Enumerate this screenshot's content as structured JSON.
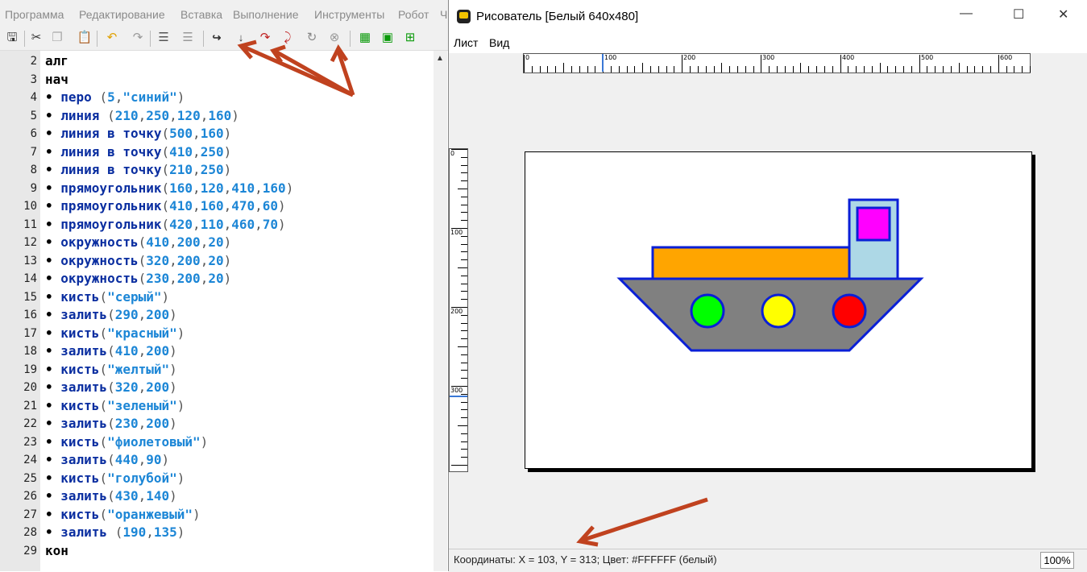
{
  "ide": {
    "menu": [
      "Программа",
      "Редактирование",
      "Вставка",
      "Выполнение",
      "Инструменты",
      "Робот",
      "Ч"
    ],
    "toolbar_icons": [
      "save-icon",
      "cut-icon",
      "copy-icon",
      "paste-icon",
      "undo-icon",
      "redo-icon",
      "indent-icon",
      "unindent-icon",
      "run-icon",
      "step-icon",
      "step-into-icon",
      "step-out-icon",
      "stop-icon",
      "grid-icon",
      "frame-icon",
      "grid-alt-icon"
    ],
    "code": [
      {
        "n": "2",
        "parts": [
          [
            "kw",
            "алг"
          ]
        ]
      },
      {
        "n": "3",
        "parts": [
          [
            "kw",
            "нач"
          ]
        ]
      },
      {
        "n": "4",
        "parts": [
          [
            "d",
            "• "
          ],
          [
            "fn",
            "перо "
          ],
          [
            "p",
            "("
          ],
          [
            "num",
            "5"
          ],
          [
            "p",
            ","
          ],
          [
            "str",
            "\"синий\""
          ],
          [
            "p",
            ")"
          ]
        ]
      },
      {
        "n": "5",
        "parts": [
          [
            "d",
            "• "
          ],
          [
            "fn",
            "линия "
          ],
          [
            "p",
            "("
          ],
          [
            "num",
            "210"
          ],
          [
            "p",
            ","
          ],
          [
            "num",
            "250"
          ],
          [
            "p",
            ","
          ],
          [
            "num",
            "120"
          ],
          [
            "p",
            ","
          ],
          [
            "num",
            "160"
          ],
          [
            "p",
            ")"
          ]
        ]
      },
      {
        "n": "6",
        "parts": [
          [
            "d",
            "• "
          ],
          [
            "fn",
            "линия в точку"
          ],
          [
            "p",
            "("
          ],
          [
            "num",
            "500"
          ],
          [
            "p",
            ","
          ],
          [
            "num",
            "160"
          ],
          [
            "p",
            ")"
          ]
        ]
      },
      {
        "n": "7",
        "parts": [
          [
            "d",
            "• "
          ],
          [
            "fn",
            "линия в точку"
          ],
          [
            "p",
            "("
          ],
          [
            "num",
            "410"
          ],
          [
            "p",
            ","
          ],
          [
            "num",
            "250"
          ],
          [
            "p",
            ")"
          ]
        ]
      },
      {
        "n": "8",
        "parts": [
          [
            "d",
            "• "
          ],
          [
            "fn",
            "линия в точку"
          ],
          [
            "p",
            "("
          ],
          [
            "num",
            "210"
          ],
          [
            "p",
            ","
          ],
          [
            "num",
            "250"
          ],
          [
            "p",
            ")"
          ]
        ]
      },
      {
        "n": "9",
        "parts": [
          [
            "d",
            "• "
          ],
          [
            "fn",
            "прямоугольник"
          ],
          [
            "p",
            "("
          ],
          [
            "num",
            "160"
          ],
          [
            "p",
            ","
          ],
          [
            "num",
            "120"
          ],
          [
            "p",
            ","
          ],
          [
            "num",
            "410"
          ],
          [
            "p",
            ","
          ],
          [
            "num",
            "160"
          ],
          [
            "p",
            ")"
          ]
        ]
      },
      {
        "n": "10",
        "parts": [
          [
            "d",
            "• "
          ],
          [
            "fn",
            "прямоугольник"
          ],
          [
            "p",
            "("
          ],
          [
            "num",
            "410"
          ],
          [
            "p",
            ","
          ],
          [
            "num",
            "160"
          ],
          [
            "p",
            ","
          ],
          [
            "num",
            "470"
          ],
          [
            "p",
            ","
          ],
          [
            "num",
            "60"
          ],
          [
            "p",
            ")"
          ]
        ]
      },
      {
        "n": "11",
        "parts": [
          [
            "d",
            "• "
          ],
          [
            "fn",
            "прямоугольник"
          ],
          [
            "p",
            "("
          ],
          [
            "num",
            "420"
          ],
          [
            "p",
            ","
          ],
          [
            "num",
            "110"
          ],
          [
            "p",
            ","
          ],
          [
            "num",
            "460"
          ],
          [
            "p",
            ","
          ],
          [
            "num",
            "70"
          ],
          [
            "p",
            ")"
          ]
        ]
      },
      {
        "n": "12",
        "parts": [
          [
            "d",
            "• "
          ],
          [
            "fn",
            "окружность"
          ],
          [
            "p",
            "("
          ],
          [
            "num",
            "410"
          ],
          [
            "p",
            ","
          ],
          [
            "num",
            "200"
          ],
          [
            "p",
            ","
          ],
          [
            "num",
            "20"
          ],
          [
            "p",
            ")"
          ]
        ]
      },
      {
        "n": "13",
        "parts": [
          [
            "d",
            "• "
          ],
          [
            "fn",
            "окружность"
          ],
          [
            "p",
            "("
          ],
          [
            "num",
            "320"
          ],
          [
            "p",
            ","
          ],
          [
            "num",
            "200"
          ],
          [
            "p",
            ","
          ],
          [
            "num",
            "20"
          ],
          [
            "p",
            ")"
          ]
        ]
      },
      {
        "n": "14",
        "parts": [
          [
            "d",
            "• "
          ],
          [
            "fn",
            "окружность"
          ],
          [
            "p",
            "("
          ],
          [
            "num",
            "230"
          ],
          [
            "p",
            ","
          ],
          [
            "num",
            "200"
          ],
          [
            "p",
            ","
          ],
          [
            "num",
            "20"
          ],
          [
            "p",
            ")"
          ]
        ]
      },
      {
        "n": "15",
        "parts": [
          [
            "d",
            "• "
          ],
          [
            "fn",
            "кисть"
          ],
          [
            "p",
            "("
          ],
          [
            "str",
            "\"серый\""
          ],
          [
            "p",
            ")"
          ]
        ]
      },
      {
        "n": "16",
        "parts": [
          [
            "d",
            "• "
          ],
          [
            "fn",
            "залить"
          ],
          [
            "p",
            "("
          ],
          [
            "num",
            "290"
          ],
          [
            "p",
            ","
          ],
          [
            "num",
            "200"
          ],
          [
            "p",
            ")"
          ]
        ]
      },
      {
        "n": "17",
        "parts": [
          [
            "d",
            "• "
          ],
          [
            "fn",
            "кисть"
          ],
          [
            "p",
            "("
          ],
          [
            "str",
            "\"красный\""
          ],
          [
            "p",
            ")"
          ]
        ]
      },
      {
        "n": "18",
        "parts": [
          [
            "d",
            "• "
          ],
          [
            "fn",
            "залить"
          ],
          [
            "p",
            "("
          ],
          [
            "num",
            "410"
          ],
          [
            "p",
            ","
          ],
          [
            "num",
            "200"
          ],
          [
            "p",
            ")"
          ]
        ]
      },
      {
        "n": "19",
        "parts": [
          [
            "d",
            "• "
          ],
          [
            "fn",
            "кисть"
          ],
          [
            "p",
            "("
          ],
          [
            "str",
            "\"желтый\""
          ],
          [
            "p",
            ")"
          ]
        ]
      },
      {
        "n": "20",
        "parts": [
          [
            "d",
            "• "
          ],
          [
            "fn",
            "залить"
          ],
          [
            "p",
            "("
          ],
          [
            "num",
            "320"
          ],
          [
            "p",
            ","
          ],
          [
            "num",
            "200"
          ],
          [
            "p",
            ")"
          ]
        ]
      },
      {
        "n": "21",
        "parts": [
          [
            "d",
            "• "
          ],
          [
            "fn",
            "кисть"
          ],
          [
            "p",
            "("
          ],
          [
            "str",
            "\"зеленый\""
          ],
          [
            "p",
            ")"
          ]
        ]
      },
      {
        "n": "22",
        "parts": [
          [
            "d",
            "• "
          ],
          [
            "fn",
            "залить"
          ],
          [
            "p",
            "("
          ],
          [
            "num",
            "230"
          ],
          [
            "p",
            ","
          ],
          [
            "num",
            "200"
          ],
          [
            "p",
            ")"
          ]
        ]
      },
      {
        "n": "23",
        "parts": [
          [
            "d",
            "• "
          ],
          [
            "fn",
            "кисть"
          ],
          [
            "p",
            "("
          ],
          [
            "str",
            "\"фиолетовый\""
          ],
          [
            "p",
            ")"
          ]
        ]
      },
      {
        "n": "24",
        "parts": [
          [
            "d",
            "• "
          ],
          [
            "fn",
            "залить"
          ],
          [
            "p",
            "("
          ],
          [
            "num",
            "440"
          ],
          [
            "p",
            ","
          ],
          [
            "num",
            "90"
          ],
          [
            "p",
            ")"
          ]
        ]
      },
      {
        "n": "25",
        "parts": [
          [
            "d",
            "• "
          ],
          [
            "fn",
            "кисть"
          ],
          [
            "p",
            "("
          ],
          [
            "str",
            "\"голубой\""
          ],
          [
            "p",
            ")"
          ]
        ]
      },
      {
        "n": "26",
        "parts": [
          [
            "d",
            "• "
          ],
          [
            "fn",
            "залить"
          ],
          [
            "p",
            "("
          ],
          [
            "num",
            "430"
          ],
          [
            "p",
            ","
          ],
          [
            "num",
            "140"
          ],
          [
            "p",
            ")"
          ]
        ]
      },
      {
        "n": "27",
        "parts": [
          [
            "d",
            "• "
          ],
          [
            "fn",
            "кисть"
          ],
          [
            "p",
            "("
          ],
          [
            "str",
            "\"оранжевый\""
          ],
          [
            "p",
            ")"
          ]
        ]
      },
      {
        "n": "28",
        "parts": [
          [
            "d",
            "• "
          ],
          [
            "fn",
            "залить "
          ],
          [
            "p",
            "("
          ],
          [
            "num",
            "190"
          ],
          [
            "p",
            ","
          ],
          [
            "num",
            "135"
          ],
          [
            "p",
            ")"
          ]
        ]
      },
      {
        "n": "29",
        "parts": [
          [
            "kw",
            "кон"
          ]
        ]
      }
    ]
  },
  "window": {
    "title": "Рисователь [Белый 640x480]",
    "controls": {
      "minimize": "—",
      "maximize": "☐",
      "close": "✕"
    },
    "menu": [
      "Лист",
      "Вид"
    ],
    "hruler_labels": [
      "0",
      "100",
      "200",
      "300",
      "400",
      "500",
      "600"
    ],
    "vruler_labels": [
      "0",
      "100",
      "200",
      "300"
    ],
    "status": "Координаты: X = 103, Y = 313; Цвет: #FFFFFF (белый)",
    "zoom": "100%"
  },
  "colors": {
    "pen": "#0a1fd6",
    "hull": "#808080",
    "cargo": "#ffa500",
    "cabin": "#add8e6",
    "window": "#ff00ff",
    "porthole_1": "#00ff00",
    "porthole_2": "#ffff00",
    "porthole_3": "#ff0000",
    "arrows": "#c0421f"
  }
}
